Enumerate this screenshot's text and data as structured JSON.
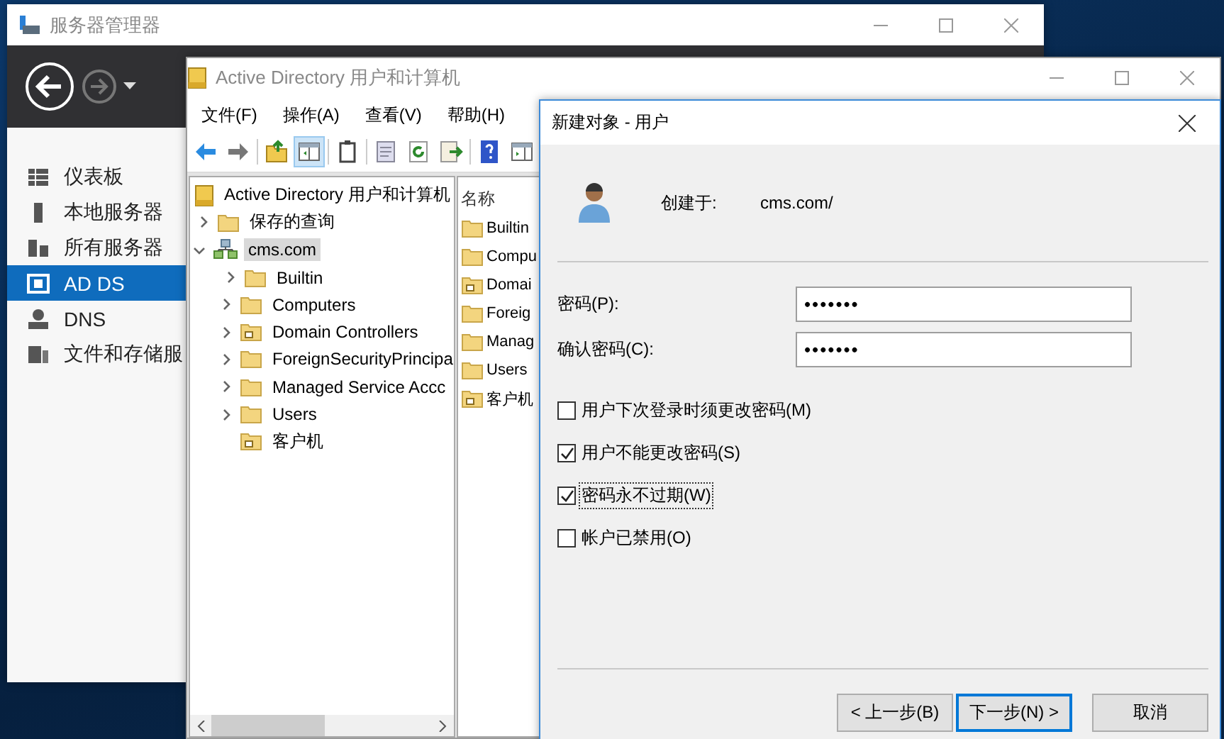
{
  "server_manager": {
    "title": "服务器管理器",
    "sidebar": [
      {
        "label": "仪表板",
        "selected": false
      },
      {
        "label": "本地服务器",
        "selected": false
      },
      {
        "label": "所有服务器",
        "selected": false
      },
      {
        "label": "AD DS",
        "selected": true
      },
      {
        "label": "DNS",
        "selected": false
      },
      {
        "label": "文件和存储服",
        "selected": false
      }
    ]
  },
  "aduc": {
    "title": "Active Directory 用户和计算机",
    "menu": [
      "文件(F)",
      "操作(A)",
      "查看(V)",
      "帮助(H)"
    ],
    "toolbar": [
      {
        "pressed": false
      },
      {
        "pressed": false
      },
      {
        "pressed": false
      },
      {
        "pressed": true
      },
      {
        "pressed": false
      },
      {
        "pressed": false
      },
      {
        "pressed": false
      },
      {
        "pressed": false
      },
      {
        "pressed": false
      },
      {
        "pressed": false
      }
    ],
    "tree": [
      {
        "label": "Active Directory 用户和计算机",
        "kind": "root",
        "selected": false,
        "children": [
          {
            "label": "保存的查询",
            "kind": "folder",
            "selected": false,
            "expanded": false
          },
          {
            "label": "cms.com",
            "kind": "domain",
            "selected": true,
            "expanded": true,
            "children": [
              {
                "label": "Builtin",
                "kind": "folder",
                "selected": false,
                "expanded": false
              },
              {
                "label": "Computers",
                "kind": "folder",
                "selected": false,
                "expanded": false
              },
              {
                "label": "Domain Controllers",
                "kind": "ou",
                "selected": false,
                "expanded": false
              },
              {
                "label": "ForeignSecurityPrincipa",
                "kind": "folder",
                "selected": false,
                "expanded": false
              },
              {
                "label": "Managed Service Accc",
                "kind": "folder",
                "selected": false,
                "expanded": false
              },
              {
                "label": "Users",
                "kind": "folder",
                "selected": false,
                "expanded": false
              },
              {
                "label": "客户机",
                "kind": "ou",
                "selected": false
              }
            ]
          }
        ]
      }
    ],
    "list": {
      "column": "名称",
      "items": [
        {
          "label": "Builtin",
          "kind": "folder"
        },
        {
          "label": "Compu",
          "kind": "folder"
        },
        {
          "label": "Domai",
          "kind": "ou"
        },
        {
          "label": "Foreig",
          "kind": "folder"
        },
        {
          "label": "Manag",
          "kind": "folder"
        },
        {
          "label": "Users",
          "kind": "folder"
        },
        {
          "label": "客户机",
          "kind": "ou"
        }
      ]
    }
  },
  "dialog": {
    "title": "新建对象 - 用户",
    "created_in_label": "创建于:",
    "created_in_value": "cms.com/",
    "fields": [
      {
        "label": "密码(P):",
        "value": "•••••••"
      },
      {
        "label": "确认密码(C):",
        "value": "•••••••"
      }
    ],
    "checkboxes": [
      {
        "label": "用户下次登录时须更改密码(M)",
        "checked": false,
        "focused": false
      },
      {
        "label": "用户不能更改密码(S)",
        "checked": true,
        "focused": false
      },
      {
        "label": "密码永不过期(W)",
        "checked": true,
        "focused": true
      },
      {
        "label": "帐户已禁用(O)",
        "checked": false,
        "focused": false
      }
    ],
    "buttons": [
      {
        "label": "< 上一步(B)",
        "default": false
      },
      {
        "label": "下一步(N) >",
        "default": true
      },
      {
        "label": "取消",
        "default": false
      }
    ]
  }
}
